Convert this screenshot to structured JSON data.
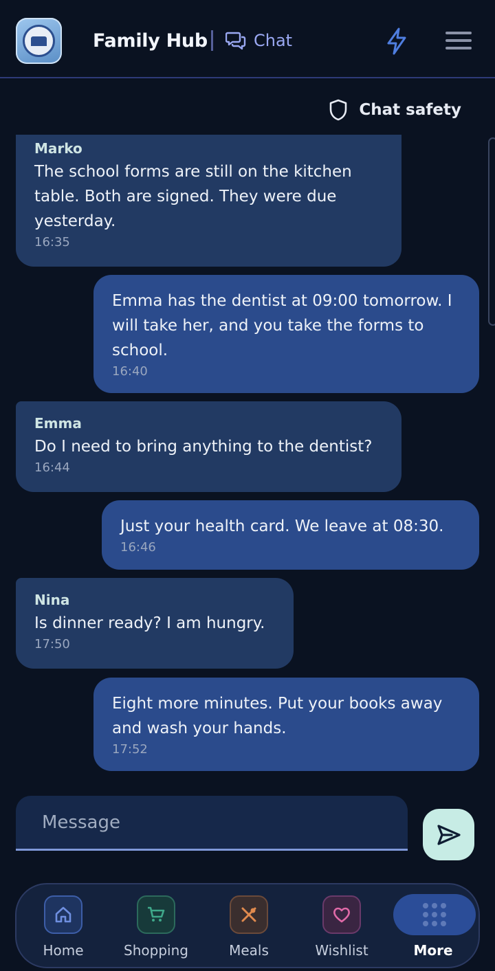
{
  "header": {
    "app_title": "Family Hub",
    "section_label": "Chat",
    "icons": {
      "logo": "family-seal-logo",
      "chat": "chat-bubbles-icon",
      "bolt": "lightning-bolt-icon",
      "menu": "hamburger-menu-icon"
    }
  },
  "safety": {
    "label": "Chat safety",
    "icon": "shield-icon"
  },
  "messages": [
    {
      "direction": "incoming",
      "sender": "Marko",
      "text": "The school forms are still on the kitchen table. Both are signed. They were due yesterday.",
      "time": "16:35"
    },
    {
      "direction": "outgoing",
      "sender": "",
      "text": "Emma has the dentist at 09:00 tomorrow. I will take her, and you take the forms to school.",
      "time": "16:40"
    },
    {
      "direction": "incoming",
      "sender": "Emma",
      "text": "Do I need to bring anything to the dentist?",
      "time": "16:44"
    },
    {
      "direction": "outgoing",
      "sender": "",
      "text": "Just your health card. We leave at 08:30.",
      "time": "16:46"
    },
    {
      "direction": "incoming",
      "sender": "Nina",
      "text": "Is dinner ready? I am hungry.",
      "time": "17:50"
    },
    {
      "direction": "outgoing",
      "sender": "",
      "text": "Eight more minutes. Put your books away and wash your hands.",
      "time": "17:52"
    }
  ],
  "composer": {
    "placeholder": "Message",
    "value": "",
    "send_icon": "send-icon"
  },
  "nav": {
    "items": [
      {
        "label": "Home",
        "icon": "home-icon",
        "color": "#6f8fe0"
      },
      {
        "label": "Shopping",
        "icon": "cart-icon",
        "color": "#3fa88a"
      },
      {
        "label": "Meals",
        "icon": "utensils-icon",
        "color": "#e08a4e"
      },
      {
        "label": "Wishlist",
        "icon": "heart-icon",
        "color": "#e06aa8"
      },
      {
        "label": "More",
        "icon": "grid-dots-icon",
        "color": "#2b4d98",
        "active": true
      }
    ]
  },
  "colors": {
    "background": "#0a1221",
    "incoming_bubble": "#223a63",
    "outgoing_bubble": "#2b4b8c",
    "accent": "#9aa8f2",
    "send_button": "#c7ece5"
  }
}
